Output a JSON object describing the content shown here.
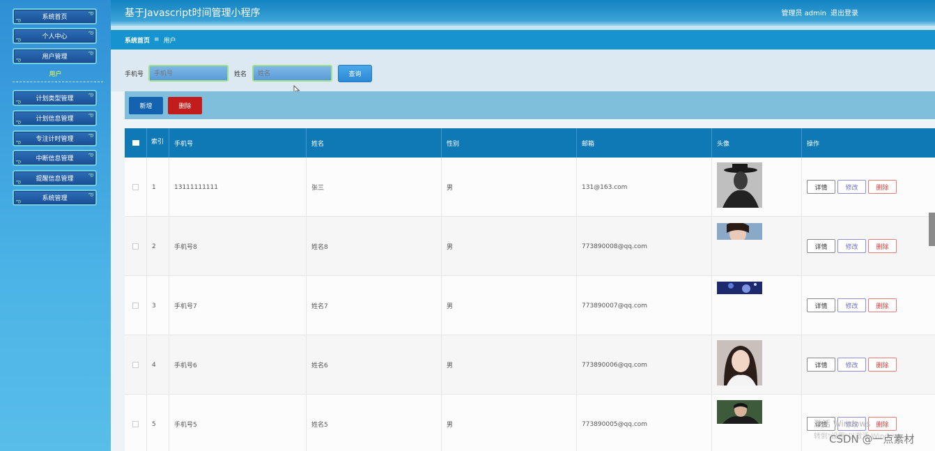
{
  "header": {
    "title": "基于Javascript时间管理小程序",
    "user_label": "管理员 admin",
    "logout": "退出登录"
  },
  "sidebar": {
    "items": [
      {
        "label": "系统首页"
      },
      {
        "label": "个人中心"
      },
      {
        "label": "用户管理"
      },
      {
        "label": "计划类型管理"
      },
      {
        "label": "计划信息管理"
      },
      {
        "label": "专注计时管理"
      },
      {
        "label": "中断信息管理"
      },
      {
        "label": "提醒信息管理"
      },
      {
        "label": "系统管理"
      }
    ],
    "sub_item": "用户"
  },
  "breadcrumb": {
    "home": "系统首页",
    "separator": "≡",
    "current": "用户"
  },
  "search": {
    "phone_label": "手机号",
    "phone_placeholder": "手机号",
    "name_label": "姓名",
    "name_placeholder": "姓名",
    "query_button": "查询"
  },
  "toolbar": {
    "add": "新增",
    "delete": "删除"
  },
  "table": {
    "headers": [
      "",
      "索引",
      "手机号",
      "姓名",
      "性别",
      "邮箱",
      "头像",
      "操作"
    ],
    "rows": [
      {
        "index": "1",
        "phone": "13111111111",
        "name": "张三",
        "gender": "男",
        "email": "131@163.com"
      },
      {
        "index": "2",
        "phone": "手机号8",
        "name": "姓名8",
        "gender": "男",
        "email": "773890008@qq.com"
      },
      {
        "index": "3",
        "phone": "手机号7",
        "name": "姓名7",
        "gender": "男",
        "email": "773890007@qq.com"
      },
      {
        "index": "4",
        "phone": "手机号6",
        "name": "姓名6",
        "gender": "男",
        "email": "773890006@qq.com"
      },
      {
        "index": "5",
        "phone": "手机号5",
        "name": "姓名5",
        "gender": "男",
        "email": "773890005@qq.com"
      }
    ],
    "actions": {
      "detail": "详情",
      "edit": "修改",
      "delete": "删除"
    }
  },
  "overlay": {
    "watermark": "CSDN @一点素材",
    "activate_windows": "激活 Windows",
    "activate_hint": "转到\"设置\"以激活 Windows。"
  }
}
